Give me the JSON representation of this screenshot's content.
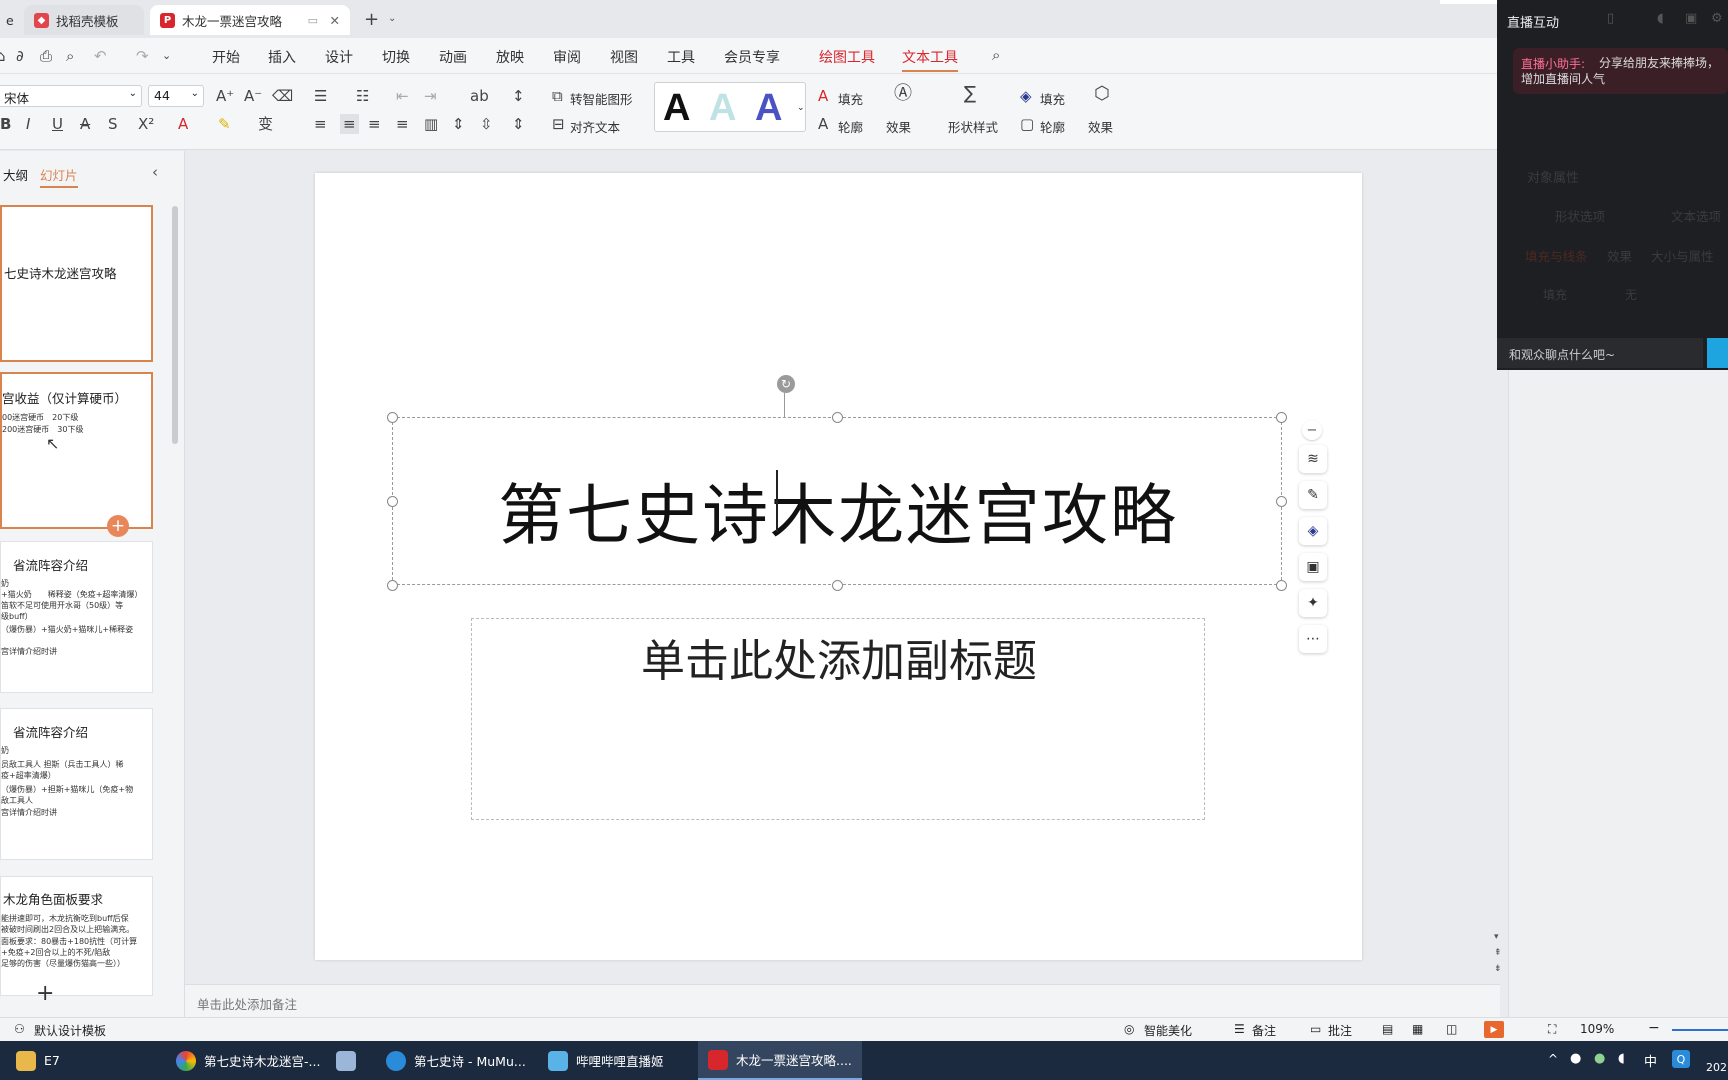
{
  "tabs": [
    {
      "label": "e"
    },
    {
      "label": "找稻壳模板"
    },
    {
      "label": "木龙一票迷宫攻略"
    }
  ],
  "menu": [
    "开始",
    "插入",
    "设计",
    "切换",
    "动画",
    "放映",
    "审阅",
    "视图",
    "工具",
    "会员专享",
    "绘图工具",
    "文本工具"
  ],
  "ribbon": {
    "font_name": "宋体",
    "font_size": "44",
    "smart_shape": "转智能图形",
    "align_text": "对齐文本",
    "fill": "填充",
    "outline": "轮廓",
    "effect": "效果",
    "shape_style": "形状样式",
    "fill2": "填充",
    "outline2": "轮廓",
    "effect2": "效果",
    "wordart_glyph": "A"
  },
  "panel": {
    "outline_tab": "大纲",
    "slides_tab": "幻灯片"
  },
  "thumbnails": [
    {
      "title": "七史诗木龙迷宫攻略",
      "lines": []
    },
    {
      "title": "宫收益（仅计算硬币）",
      "lines": [
        "00迷宫硬币　20下级",
        "200迷宫硬币　30下级"
      ]
    },
    {
      "title": "省流阵容介绍",
      "lines": [
        "奶",
        "+猫火奶　　稀释姿（免疫+超率清爆）",
        "笛软不足可使用开水哥（50级）等",
        "级buff）",
        "（爆伤暴）+猫火奶+猫咪儿+稀释姿",
        "",
        "宫详情介绍时讲"
      ]
    },
    {
      "title": "省流阵容介绍",
      "lines": [
        "奶",
        "员敌工具人 担斯（兵击工具人）稀",
        "疫+超率清爆）",
        "（爆伤暴）+担斯+猫咪儿（免疫+物",
        "敌工具人",
        "宫详情介绍时讲"
      ]
    },
    {
      "title": "木龙角色面板要求",
      "lines": [
        "能拼速即可，木龙抗衡吃到buff后保",
        "被破时间刷出2回合及以上把输满充。",
        "面板要求：80暴击+180抗性（可计算",
        "+免疫+2回合以上的不死/陷敌",
        "足够的伤害（尽量爆伤猫高一些））"
      ]
    }
  ],
  "slide": {
    "title": "第七史诗木龙迷宫攻略",
    "subtitle": "单击此处添加副标题"
  },
  "notes_placeholder": "单击此处添加备注",
  "live": {
    "title": "直播互动",
    "assistant_label": "直播小助手:",
    "assistant_msg": "分享给朋友来捧捧场，增加直播间人气",
    "object_props": "对象属性",
    "tab_a": "形状选项",
    "tab_b": "文本选项",
    "sub_a": "填充与线条",
    "sub_b": "效果",
    "sub_c": "大小与属性",
    "fill_label": "填充",
    "fill_value": "无",
    "chat_placeholder": "和观众聊点什么吧~"
  },
  "status": {
    "template": "默认设计模板",
    "beautify": "智能美化",
    "notes": "备注",
    "comment": "批注",
    "zoom": "109%"
  },
  "taskbar": {
    "start": "E7",
    "items": [
      "第七史诗木龙迷宫-...",
      "第七史诗 - MuMu...",
      "哔哩哔哩直播姬",
      "木龙一票迷宫攻略...."
    ],
    "ime": "中",
    "year": "202"
  },
  "colors": {
    "accent": "#d8844f",
    "wps_red": "#d7262c",
    "taskbar": "#1c2a3f"
  }
}
